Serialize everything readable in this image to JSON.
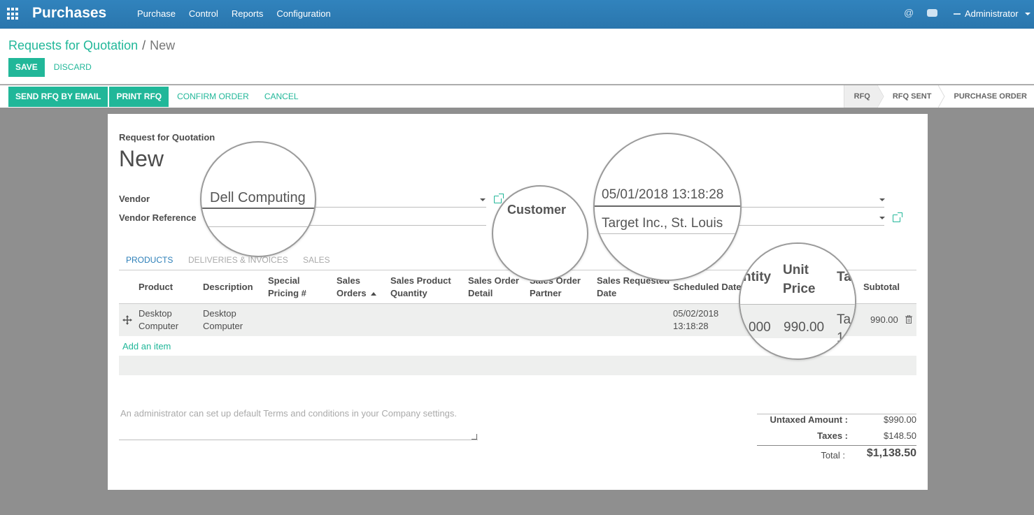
{
  "navbar": {
    "brand": "Purchases",
    "menu": [
      "Purchase",
      "Control",
      "Reports",
      "Configuration"
    ],
    "user": "Administrator",
    "icons": [
      "apps-grid-icon",
      "at-icon",
      "chat-icon",
      "avatar-icon"
    ]
  },
  "breadcrumb": {
    "parent": "Requests for Quotation",
    "separator": "/",
    "current": "New"
  },
  "buttons": {
    "save": "SAVE",
    "discard": "DISCARD"
  },
  "statusbar": {
    "actions": {
      "send_email": "SEND RFQ BY EMAIL",
      "print": "PRINT RFQ",
      "confirm": "CONFIRM ORDER",
      "cancel": "CANCEL"
    },
    "stages": [
      "RFQ",
      "RFQ SENT",
      "PURCHASE ORDER"
    ],
    "active_stage": "RFQ"
  },
  "form": {
    "doc_label": "Request for Quotation",
    "title": "New",
    "vendor_label": "Vendor",
    "vendor_value": "Dell Computing",
    "vendor_ref_label": "Vendor Reference",
    "customer_label": "Customer",
    "date_value": "05/01/2018 13:18:28",
    "customer_value": "Target Inc., St. Louis"
  },
  "tabs": [
    "PRODUCTS",
    "DELIVERIES & INVOICES",
    "SALES"
  ],
  "table": {
    "headers": {
      "product": "Product",
      "description": "Description",
      "special_1": "Special",
      "special_2": "Pricing #",
      "sales_orders_1": "Sales",
      "sales_orders_2": "Orders",
      "spq_1": "Sales Product",
      "spq_2": "Quantity",
      "sod_1": "Sales Order",
      "sod_2": "Detail",
      "sop_1": "Sales Order",
      "sop_2": "Partner",
      "srd_1": "Sales Requested",
      "srd_2": "Date",
      "scheduled": "Scheduled Date",
      "quantity_partial": "ntity",
      "unit_price_1": "Unit",
      "unit_price_2": "Price",
      "taxes_partial": "Ta",
      "subtotal": "Subtotal"
    },
    "row": {
      "product_1": "Desktop",
      "product_2": "Computer",
      "description_1": "Desktop",
      "description_2": "Computer",
      "scheduled_1": "05/02/2018",
      "scheduled_2": "13:18:28",
      "quantity_partial": "000",
      "unit_price": "990.00",
      "taxes_partial_1": "Ta",
      "taxes_partial_2": "1",
      "subtotal": "990.00"
    },
    "add_item": "Add an item"
  },
  "footer": {
    "terms_placeholder": "An administrator can set up default Terms and conditions in your Company settings.",
    "untaxed_label": "Untaxed Amount :",
    "untaxed_value": "$990.00",
    "taxes_label": "Taxes :",
    "taxes_value": "$148.50",
    "total_label": "Total :",
    "total_value": "$1,138.50"
  },
  "colors": {
    "navbar": "#2c7fb8",
    "accent": "#21b799",
    "background": "#8f8f8f"
  }
}
